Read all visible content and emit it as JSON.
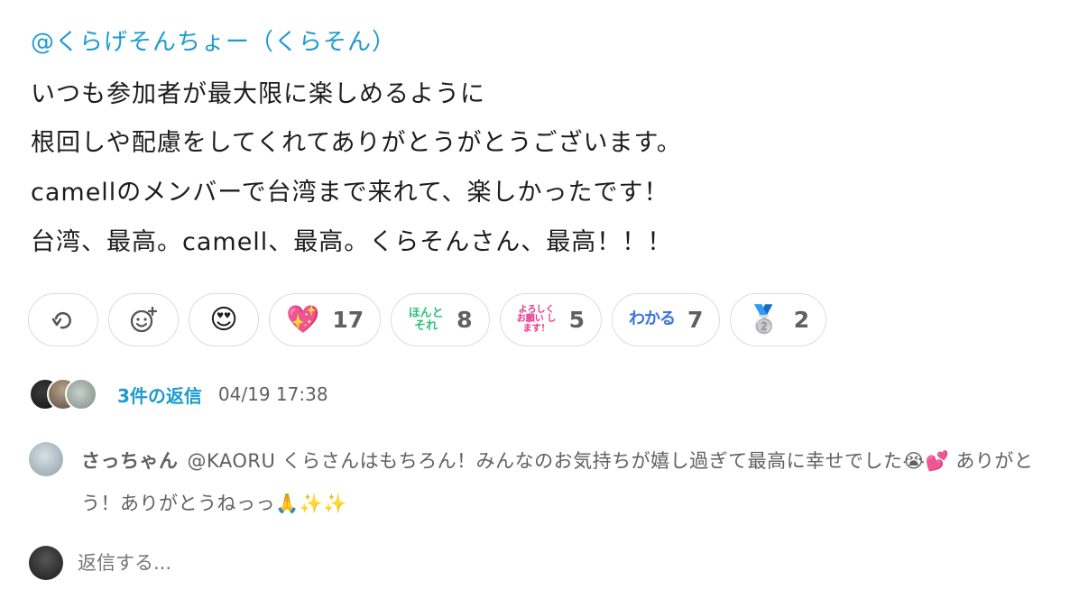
{
  "message": {
    "mention": "@くらげそんちょー（くらそん）",
    "lines": [
      "いつも参加者が最大限に楽しめるように",
      "根回しや配慮をしてくれてありがとうがとうございます。",
      "camellのメンバーで台湾まで来れて、楽しかったです！",
      "台湾、最高。camell、最高。くらそんさん、最高！！！"
    ]
  },
  "reactions": [
    {
      "icon": "reply-thread-icon"
    },
    {
      "icon": "add-reaction-icon"
    },
    {
      "icon": "heart-eyes-emoji",
      "glyph": "😍"
    },
    {
      "icon": "sparkling-heart-emoji",
      "glyph": "💖",
      "count": "17"
    },
    {
      "icon": "honto-sore-stamp",
      "text": "ほんと それ",
      "count": "8"
    },
    {
      "icon": "yoroshiku-stamp",
      "text": "よろしく お願い します！",
      "count": "5"
    },
    {
      "icon": "wakaru-stamp",
      "text": "わかる",
      "count": "7"
    },
    {
      "icon": "second-place-medal-emoji",
      "glyph": "🥈",
      "count": "2"
    }
  ],
  "thread": {
    "reply_count": "3件の返信",
    "timestamp": "04/19 17:38"
  },
  "reply": {
    "author": "さっちゃん",
    "text": "@KAORU くらさんはもちろん！みんなのお気持ちが嬉し過ぎて最高に幸せでした😭💕 ありがとう！ありがとうねっっ🙏✨✨"
  },
  "compose": {
    "placeholder": "返信する..."
  },
  "colors": {
    "link": "#1d9bd1",
    "text": "#1d1c1d",
    "muted": "#616061",
    "pill_border": "#dcdcdc"
  }
}
